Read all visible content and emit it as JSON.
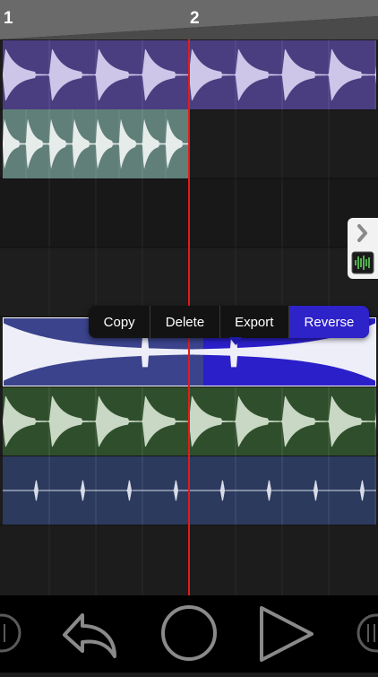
{
  "ruler": {
    "bars": [
      {
        "label": "1"
      },
      {
        "label": "2"
      }
    ]
  },
  "context_menu": {
    "items": [
      {
        "label": "Copy",
        "name": "copy-menu-item"
      },
      {
        "label": "Delete",
        "name": "delete-menu-item"
      },
      {
        "label": "Export",
        "name": "export-menu-item"
      },
      {
        "label": "Reverse",
        "name": "reverse-menu-item",
        "active": true
      }
    ]
  },
  "tracks": [
    {
      "name": "track-1",
      "region_color": "#4a3d80",
      "wave_color": "#cdc6e8",
      "envelope": "pluck"
    },
    {
      "name": "track-2",
      "region_color": "#5f7f78",
      "wave_color": "#e6ecea",
      "envelope": "pluck"
    },
    {
      "name": "track-3"
    },
    {
      "name": "track-4"
    },
    {
      "name": "track-5",
      "region_color": "#3a438c",
      "reversed_color": "#2b1fc9",
      "wave_color": "#eeeef8",
      "envelope": "swell"
    },
    {
      "name": "track-6",
      "region_color": "#2f4f2c",
      "wave_color": "#c8d8c4",
      "envelope": "pluck"
    },
    {
      "name": "track-7",
      "region_color": "#2c3a5e",
      "wave_color": "#d8dce8",
      "envelope": "tick"
    }
  ],
  "colors": {
    "playhead": "#e41b1b",
    "background": "#1c1c1c",
    "menu_active": "#2e22c9"
  },
  "transport": {
    "buttons": [
      {
        "name": "undo-button",
        "icon": "undo-arrow-icon"
      },
      {
        "name": "record-button",
        "icon": "circle-icon"
      },
      {
        "name": "play-button",
        "icon": "play-triangle-icon"
      }
    ]
  },
  "side_panel": {
    "icons": [
      "chevron-right-icon",
      "waveform-thumbnail-icon"
    ]
  }
}
